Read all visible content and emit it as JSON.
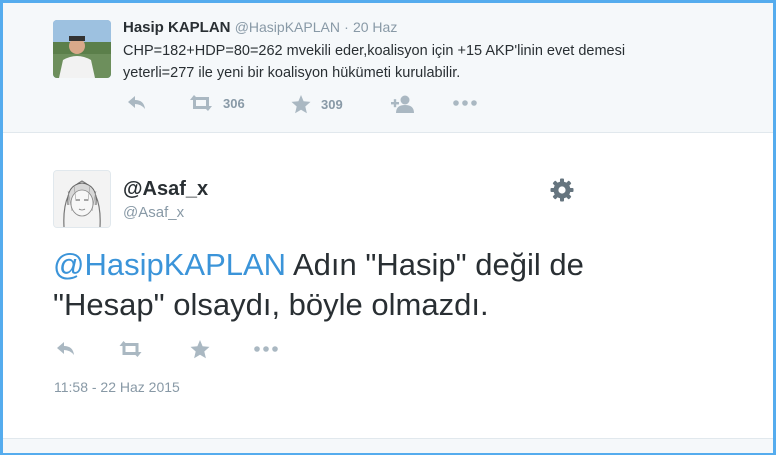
{
  "top_tweet": {
    "name": "Hasip KAPLAN",
    "handle": "@HasipKAPLAN",
    "separator": "·",
    "date": "20 Haz",
    "text_line1": "CHP=182+HDP=80=262 mvekili eder,koalisyon için +15 AKP'linin evet demesi",
    "text_line2": "yeterli=277 ile yeni bir koalisyon hükümeti kurulabilir.",
    "retweet_count": "306",
    "favorite_count": "309"
  },
  "main_tweet": {
    "name": "@Asaf_x",
    "handle": "@Asaf_x",
    "mention": "@HasipKAPLAN",
    "text_part1": " Adın \"Hasip\" değil de",
    "text_part2": "\"Hesap\" olsaydı, böyle olmazdı.",
    "timestamp": "11:58 - 22 Haz 2015"
  },
  "colors": {
    "frame": "#55acee",
    "link": "#3b94d9",
    "muted": "#8899a6",
    "icon": "#aab8c2"
  }
}
